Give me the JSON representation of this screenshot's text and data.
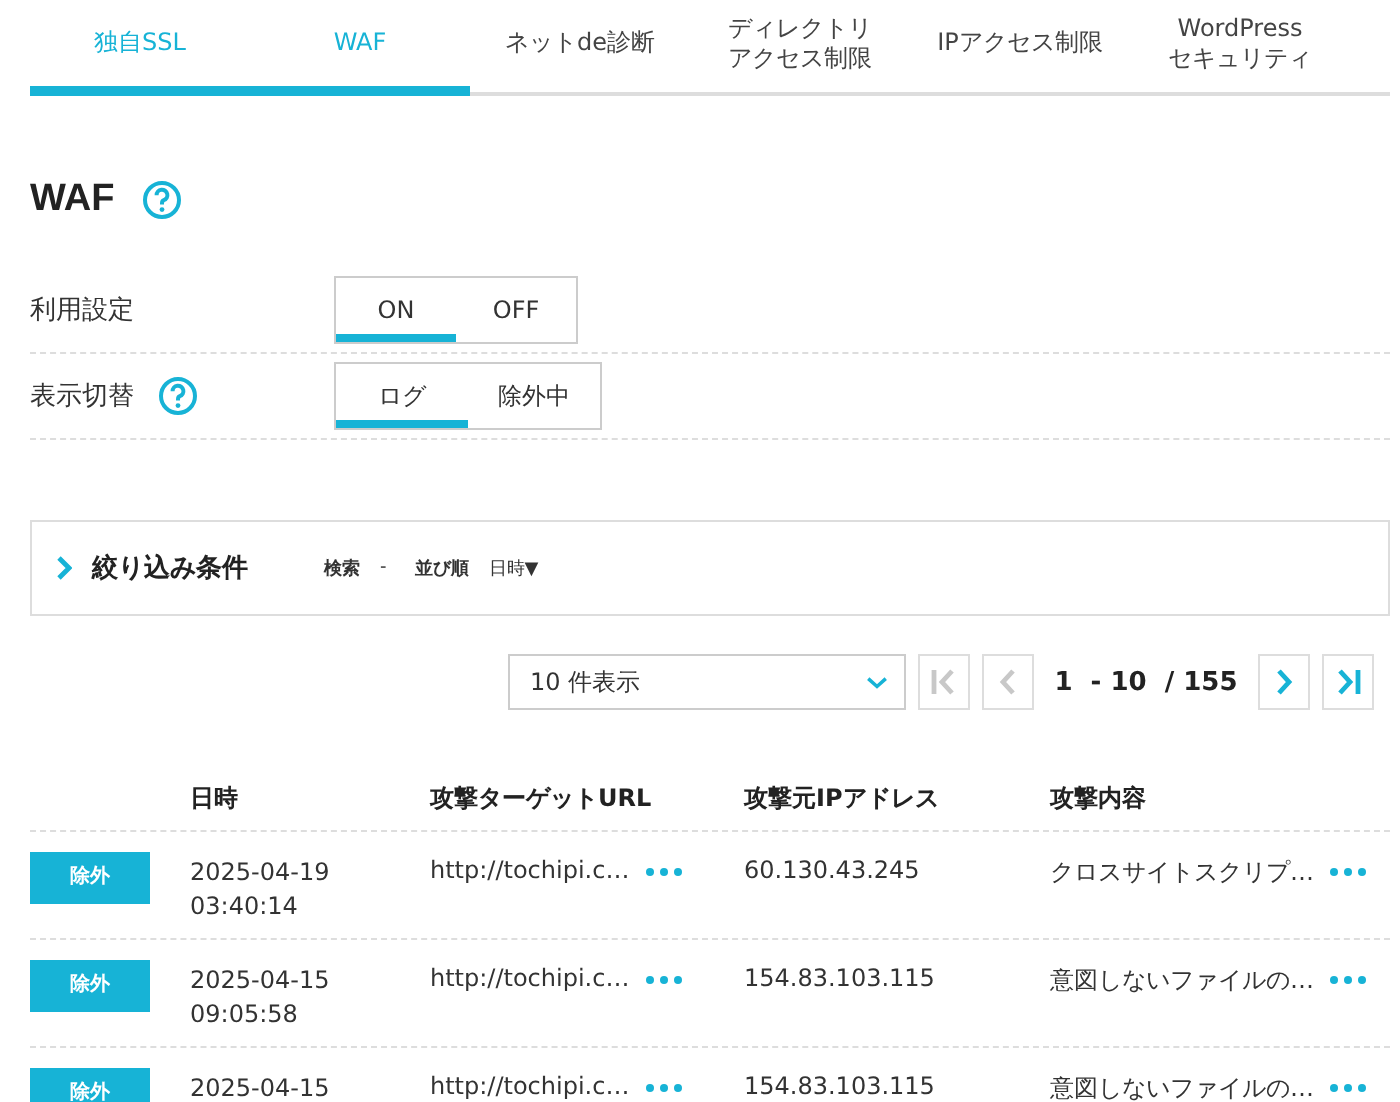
{
  "tabs": [
    {
      "label": "独自SSL",
      "selected": true
    },
    {
      "label": "WAF",
      "selected": true
    },
    {
      "label": "ネットde診断",
      "selected": false
    },
    {
      "label": [
        "ディレクトリ",
        "アクセス制限"
      ],
      "selected": false
    },
    {
      "label": "IPアクセス制限",
      "selected": false
    },
    {
      "label": [
        "WordPress",
        "セキュリティ"
      ],
      "selected": false
    }
  ],
  "heading": "WAF",
  "settings": [
    {
      "label": "利用設定",
      "help": false,
      "options": [
        {
          "label": "ON",
          "selected": true
        },
        {
          "label": "OFF",
          "selected": false
        }
      ]
    },
    {
      "label": "表示切替",
      "help": true,
      "options": [
        {
          "label": "ログ",
          "selected": true
        },
        {
          "label": "除外中",
          "selected": false
        }
      ]
    }
  ],
  "filter": {
    "title": "絞り込み条件",
    "search_label": "検索",
    "search_value": "-",
    "sort_label": "並び順",
    "sort_value": "日時▼"
  },
  "pagination": {
    "per_page": "10 件表示",
    "range": "1  - 10  / 155"
  },
  "table": {
    "columns": [
      "日時",
      "攻撃ターゲットURL",
      "攻撃元IPアドレス",
      "攻撃内容"
    ],
    "rows": [
      {
        "badge": "除外",
        "date": "2025-04-19",
        "time": "03:40:14",
        "url": "http://tochipi.c…",
        "ip": "60.130.43.245",
        "content": "クロスサイトスクリプ…"
      },
      {
        "badge": "除外",
        "date": "2025-04-15",
        "time": "09:05:58",
        "url": "http://tochipi.c…",
        "ip": "154.83.103.115",
        "content": "意図しないファイルの…"
      },
      {
        "badge": "除外",
        "date": "2025-04-15",
        "time": "",
        "url": "http://tochipi.c…",
        "ip": "154.83.103.115",
        "content": "意図しないファイルの…"
      }
    ]
  }
}
